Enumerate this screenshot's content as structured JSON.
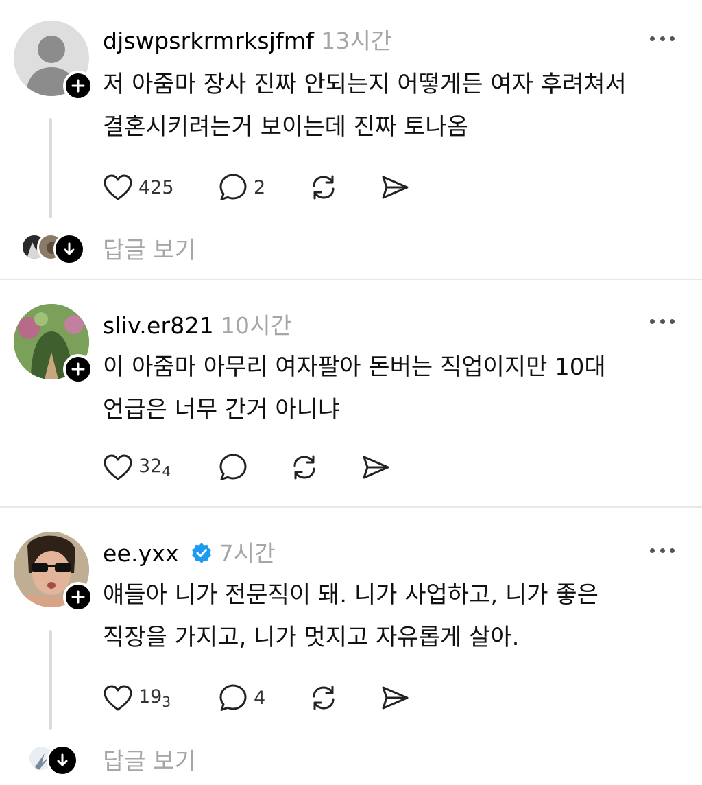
{
  "posts": [
    {
      "username": "djswpsrkrmrksjfmf",
      "time": "13시간",
      "text": "저 아줌마 장사 진짜 안되는지 어떻게든 여자 후려쳐서\n결혼시키려는거 보이는데 진짜 토나옴",
      "likes": "425",
      "likes_sub": "",
      "comments": "2",
      "replies_label": "답글 보기",
      "avatar": "default-person-avatar"
    },
    {
      "username": "sliv.er821",
      "time": "10시간",
      "text": "이 아줌마 아무리 여자팔아 돈버는 직업이지만 10대\n언급은 너무 간거 아니냐",
      "likes": "32",
      "likes_sub": "4",
      "comments": "",
      "avatar": "garden-photo-avatar"
    },
    {
      "username": "ee.yxx",
      "verified": true,
      "time": "7시간",
      "text": "얘들아 니가 전문직이 돼. 니가 사업하고, 니가 좋은\n직장을 가지고, 니가 멋지고 자유롭게 살아.",
      "likes": "19",
      "likes_sub": "3",
      "comments": "4",
      "replies_label": "답글 보기",
      "avatar": "sunglasses-person-avatar"
    }
  ],
  "icons": {
    "like": "heart-icon",
    "comment": "comment-bubble-icon",
    "repost": "repost-icon",
    "share": "send-icon",
    "more": "more-dots-icon",
    "follow": "plus-icon",
    "expand": "arrow-down-icon",
    "verified": "verified-badge-icon"
  },
  "colors": {
    "verified": "#1d9bf0",
    "secondary_text": "#a6a6a6",
    "divider": "#e8e8e8"
  }
}
